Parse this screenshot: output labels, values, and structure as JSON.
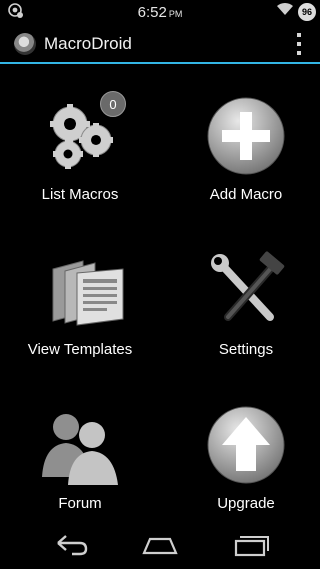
{
  "status_bar": {
    "time": "6:52",
    "ampm": "PM",
    "battery": "96",
    "icons": [
      "notification-icon",
      "wifi-icon",
      "battery-icon"
    ]
  },
  "action_bar": {
    "title": "MacroDroid",
    "accent_color": "#33b5e5"
  },
  "tiles": {
    "list_macros": {
      "label": "List Macros",
      "badge": "0",
      "icon": "gears-icon"
    },
    "add_macro": {
      "label": "Add Macro",
      "icon": "plus-circle-icon"
    },
    "view_templates": {
      "label": "View Templates",
      "icon": "templates-icon"
    },
    "settings": {
      "label": "Settings",
      "icon": "wrench-hammer-icon"
    },
    "forum": {
      "label": "Forum",
      "icon": "people-icon"
    },
    "upgrade": {
      "label": "Upgrade",
      "icon": "up-arrow-circle-icon"
    }
  },
  "nav_bar": {
    "icons": [
      "back-icon",
      "home-icon",
      "recents-icon"
    ]
  }
}
